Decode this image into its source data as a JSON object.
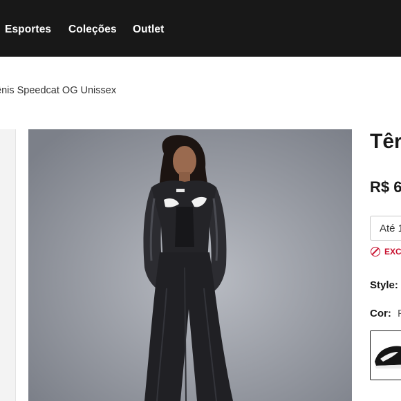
{
  "nav": {
    "items": [
      {
        "label": "Esportes"
      },
      {
        "label": "Coleções"
      },
      {
        "label": "Outlet"
      }
    ]
  },
  "breadcrumb": {
    "current": "ênis Speedcat OG Unissex"
  },
  "product": {
    "title": "Têr",
    "price": "R$ 6",
    "size_select_value": "Até 1",
    "exclusive_badge": "EXCL",
    "style_label": "Style:",
    "color_label": "Cor:",
    "color_value": "P"
  },
  "colors": {
    "nav_bg": "#181818",
    "accent_red": "#c8102e",
    "image_bg": "#969aa3"
  },
  "icons": {
    "exclusive": "prohibited-icon"
  }
}
